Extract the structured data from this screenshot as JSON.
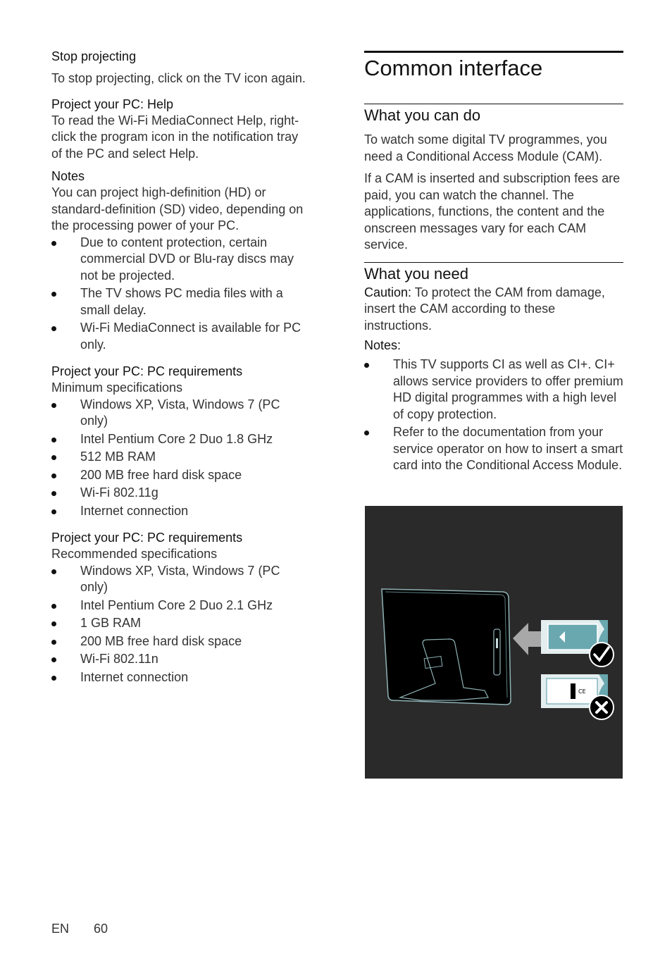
{
  "left": {
    "stop_projecting": {
      "heading": "Stop projecting",
      "text": "To stop projecting, click on the TV icon again."
    },
    "help": {
      "heading": "Project your PC: Help",
      "text": "To read the Wi-Fi MediaConnect Help, right-click the program icon in the notification tray of the PC and select Help."
    },
    "notes": {
      "heading": "Notes",
      "text": "You can project high-definition (HD) or standard-definition (SD) video, depending on the processing power of your PC.",
      "items": [
        "Due to content protection, certain commercial DVD or Blu-ray discs may not be projected.",
        "The TV shows PC media files with a small delay.",
        "Wi-Fi MediaConnect is available for PC only."
      ]
    },
    "min_req": {
      "heading": "Project your PC: PC requirements",
      "subheading": "Minimum specifications",
      "items": [
        "Windows XP, Vista, Windows 7 (PC only)",
        "Intel Pentium Core 2 Duo 1.8 GHz",
        "512 MB RAM",
        "200 MB free hard disk space",
        "Wi-Fi 802.11g",
        "Internet connection"
      ]
    },
    "rec_req": {
      "heading": "Project your PC: PC requirements",
      "subheading": "Recommended specifications",
      "items": [
        "Windows XP, Vista, Windows 7 (PC only)",
        "Intel Pentium Core 2 Duo 2.1 GHz",
        "1 GB RAM",
        "200 MB free hard disk space",
        "Wi-Fi 802.11n",
        "Internet connection"
      ]
    }
  },
  "right": {
    "title": "Common interface",
    "can_do": {
      "heading": "What you can do",
      "p1": "To watch some digital TV programmes, you need a Conditional Access Module (CAM).",
      "p2": "If a CAM is inserted and subscription fees are paid, you can watch the channel. The applications, functions, the content and the onscreen messages vary for each CAM service."
    },
    "need": {
      "heading": "What you need",
      "caution_label": "Caution:",
      "caution_text": " To protect the CAM from damage, insert the CAM according to these instructions.",
      "notes_label": "Notes:",
      "items": [
        "This TV supports CI as well as CI+. CI+ allows service providers to offer premium HD digital programmes with a high level of copy protection.",
        "Refer to the documentation from your service operator on how to insert a smart card into the Conditional Access Module."
      ]
    },
    "figure": {
      "description": "CAM insertion illustration: TV rear with slot, correct orientation (check) and incorrect orientation (cross)",
      "colors": {
        "background": "#2a2a2a",
        "card_teal": "#6aa8b0",
        "arrow": "#a8a8a8"
      }
    }
  },
  "footer": {
    "lang": "EN",
    "page": "60"
  }
}
